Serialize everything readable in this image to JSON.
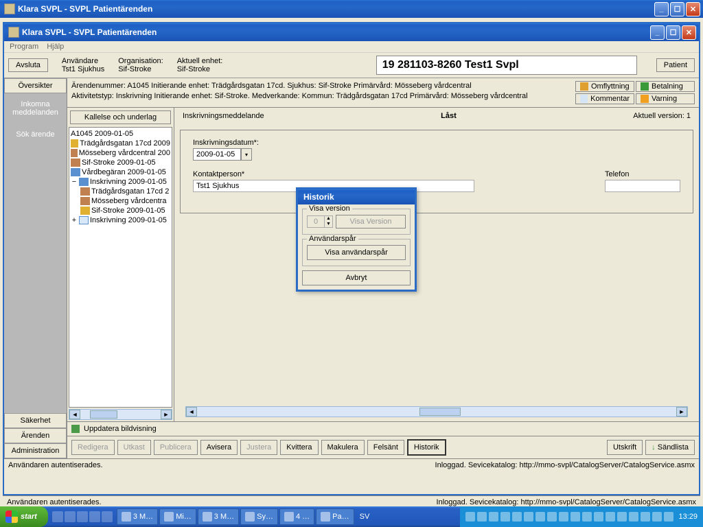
{
  "outer_window": {
    "title": "Klara SVPL - SVPL Patientärenden"
  },
  "inner_window": {
    "title": "Klara SVPL - SVPL Patientärenden"
  },
  "menubar": {
    "program": "Program",
    "hjalp": "Hjälp"
  },
  "toolbar": {
    "avsluta": "Avsluta",
    "anvandare_label": "Användare",
    "anvandare_value": "Tst1 Sjukhus",
    "organisation_label": "Organisation:",
    "organisation_value": "Sif-Stroke",
    "aktuell_label": "Aktuell enhet:",
    "aktuell_value": "Sif-Stroke",
    "patient_id": "19 281103-8260 Test1 Svpl",
    "patient_btn": "Patient"
  },
  "leftnav": {
    "oversikter": "Översikter",
    "inkomna": "Inkomna meddelanden",
    "sok": "Sök ärende",
    "sakerhet": "Säkerhet",
    "arenden": "Ärenden",
    "admin": "Administration"
  },
  "info": {
    "line1": "Ärendenummer: A1045        Initierande enhet: Trädgårdsgatan 17cd.  Sjukhus: Sif-Stroke   Primärvård: Mösseberg vårdcentral",
    "line2": "Aktivitetstyp: Inskrivning         Initierande enhet: Sif-Stroke. Medverkande: Kommun: Trädgårdsgatan 17cd  Primärvård: Mösseberg vårdcentral",
    "omflyttning": "Omflyttning",
    "betalning": "Betalning",
    "kommentar": "Kommentar",
    "varning": "Varning"
  },
  "tree": {
    "kallelse_btn": "Kallelse och underlag",
    "root": "A1045 2009-01-05",
    "i1": "Trädgårdsgatan 17cd 2009",
    "i2": "Mösseberg vårdcentral 200",
    "i3": "Sif-Stroke 2009-01-05",
    "i4": "Vårdbegäran 2009-01-05",
    "i5": "Inskrivning 2009-01-05",
    "i5a": "Trädgårdsgatan 17cd 2",
    "i5b": "Mösseberg vårdcentra",
    "i5c": "Sif-Stroke 2009-01-05",
    "i6": "Inskrivning 2009-01-05"
  },
  "form": {
    "title": "Inskrivningsmeddelande",
    "locked": "Låst",
    "version": "Aktuell version: 1",
    "insk_label": "Inskrivningsdatum*:",
    "insk_value": "2009-01-05",
    "kontakt_label": "Kontaktperson*",
    "kontakt_value": "Tst1 Sjukhus",
    "telefon_label": "Telefon"
  },
  "bottom": {
    "uppdatera": "Uppdatera bildvisning",
    "redigera": "Redigera",
    "utkast": "Utkast",
    "publicera": "Publicera",
    "avisera": "Avisera",
    "justera": "Justera",
    "kvittera": "Kvittera",
    "makulera": "Makulera",
    "felsant": "Felsänt",
    "historik": "Historik",
    "utskrift": "Utskrift",
    "sandlista": "Sändlista"
  },
  "status": {
    "left": "Användaren autentiserades.",
    "right": "Inloggad. Sevicekatalog: http://mmo-svpl/CatalogServer/CatalogService.asmx"
  },
  "dialog": {
    "title": "Historik",
    "visa_version_legend": "Visa version",
    "spin_value": "0",
    "visa_version_btn": "Visa Version",
    "anvsp_legend": "Användarspår",
    "anvsp_btn": "Visa användarspår",
    "avbryt": "Avbryt"
  },
  "taskbar": {
    "start": "start",
    "items": [
      "3 M…",
      "Mi…",
      "3 M…",
      "Sy…",
      "4 …",
      "Pa…"
    ],
    "lang": "SV",
    "clock": "13:29"
  }
}
